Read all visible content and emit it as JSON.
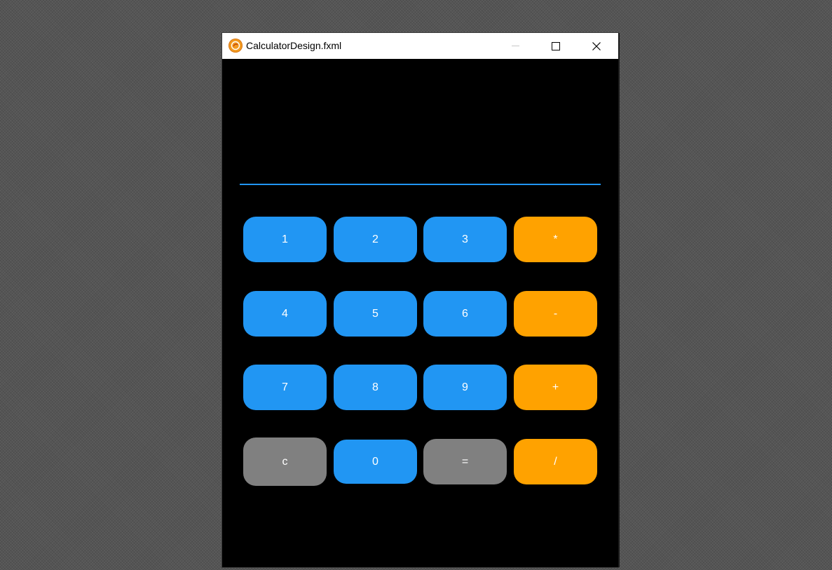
{
  "window": {
    "title": "CalculatorDesign.fxml",
    "icon": "javafx-app-icon"
  },
  "titlebar_controls": {
    "minimize_icon": "minimize-icon",
    "maximize_icon": "maximize-icon",
    "close_icon": "close-icon"
  },
  "display": {
    "value": ""
  },
  "keypad": {
    "rows": [
      [
        "1",
        "2",
        "3",
        "*"
      ],
      [
        "4",
        "5",
        "6",
        "-"
      ],
      [
        "7",
        "8",
        "9",
        "+"
      ],
      [
        "c",
        "0",
        "=",
        "/"
      ]
    ]
  },
  "colors": {
    "number_key": "#2196f3",
    "operator_key": "#ffa200",
    "function_key": "#808080",
    "display_underline": "#2196f3",
    "background": "#000000"
  }
}
